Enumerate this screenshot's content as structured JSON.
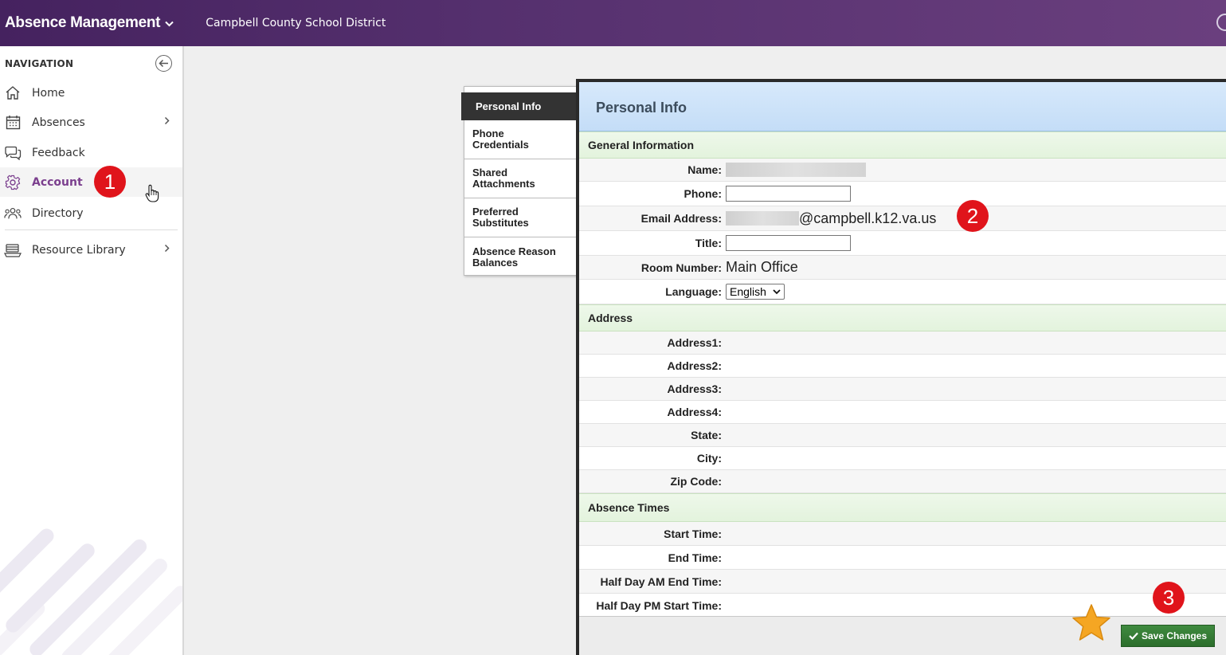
{
  "header": {
    "app_title": "Absence Management",
    "district": "Campbell County School District"
  },
  "sidebar": {
    "heading": "NAVIGATION",
    "items": [
      {
        "label": "Home",
        "icon": "home-icon"
      },
      {
        "label": "Absences",
        "icon": "calendar-icon",
        "has_submenu": true
      },
      {
        "label": "Feedback",
        "icon": "chat-icon"
      },
      {
        "label": "Account",
        "icon": "gear-icon",
        "active": true
      },
      {
        "label": "Directory",
        "icon": "people-icon"
      },
      {
        "label": "Resource Library",
        "icon": "library-icon",
        "has_submenu": true
      }
    ]
  },
  "tabs": [
    {
      "label": "Personal Info",
      "active": true
    },
    {
      "label": "Phone Credentials"
    },
    {
      "label": "Shared Attachments"
    },
    {
      "label": "Preferred Substitutes"
    },
    {
      "label": "Absence Reason Balances"
    }
  ],
  "panel": {
    "title": "Personal Info",
    "general_heading": "General Information",
    "name_label": "Name:",
    "phone_label": "Phone:",
    "phone_value": "",
    "email_label": "Email Address:",
    "email_domain": "@campbell.k12.va.us",
    "title_label": "Title:",
    "title_value": "",
    "room_label": "Room Number:",
    "room_value": "Main Office",
    "language_label": "Language:",
    "language_value": "English",
    "address_heading": "Address",
    "address_fields": [
      "Address1:",
      "Address2:",
      "Address3:",
      "Address4:",
      "State:",
      "City:",
      "Zip Code:"
    ],
    "absence_heading": "Absence Times",
    "absence_fields": [
      "Start Time:",
      "End Time:",
      "Half Day AM End Time:",
      "Half Day PM Start Time:"
    ],
    "save_label": "Save Changes"
  },
  "annotations": {
    "step1": "1",
    "step2": "2",
    "step3": "3"
  },
  "colors": {
    "topbar": "#55306e",
    "active_nav": "#7b3f8e",
    "badge": "#e0141b",
    "save_button": "#2c6e2c",
    "star": "#f5a623"
  }
}
